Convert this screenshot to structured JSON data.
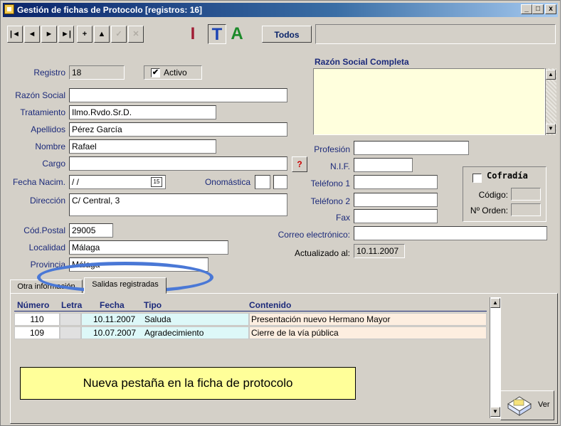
{
  "window": {
    "title": "Gestión de fichas de Protocolo  [registros: 16]",
    "controls": [
      "_",
      "□",
      "x"
    ]
  },
  "toolbar": {
    "nav": [
      "|◄",
      "◄",
      "►",
      "►|",
      "+",
      "▲",
      "✓",
      "✕"
    ],
    "letters": [
      {
        "text": "I",
        "color": "#a01c34"
      },
      {
        "text": "T",
        "color": "#1c44b4"
      },
      {
        "text": "A",
        "color": "#1c8a2a"
      }
    ],
    "todos": "Todos"
  },
  "form": {
    "registro": {
      "label": "Registro",
      "value": "18"
    },
    "activo": {
      "label": "Activo",
      "checked": "✔"
    },
    "razon_social": {
      "label": "Razón Social",
      "value": ""
    },
    "tratamiento": {
      "label": "Tratamiento",
      "value": "Ilmo.Rvdo.Sr.D."
    },
    "apellidos": {
      "label": "Apellidos",
      "value": "Pérez García"
    },
    "nombre": {
      "label": "Nombre",
      "value": "Rafael"
    },
    "cargo": {
      "label": "Cargo",
      "value": "",
      "help": "?"
    },
    "fecha_nacim": {
      "label": "Fecha Nacim.",
      "value": " / /",
      "calendar": "15"
    },
    "onomastica": {
      "label": "Onomástica"
    },
    "direccion": {
      "label": "Dirección",
      "value": "C/ Central, 3"
    },
    "cod_postal": {
      "label": "Cód.Postal",
      "value": "29005"
    },
    "localidad": {
      "label": "Localidad",
      "value": "Málaga"
    },
    "provincia": {
      "label": "Provincia",
      "value": "Málaga"
    },
    "razon_completa": {
      "label": "Razón Social Completa"
    },
    "profesion": {
      "label": "Profesión"
    },
    "nif": {
      "label": "N.I.F."
    },
    "telefono1": {
      "label": "Teléfono 1"
    },
    "telefono2": {
      "label": "Teléfono 2"
    },
    "fax": {
      "label": "Fax"
    },
    "correo": {
      "label": "Correo electrónico:"
    },
    "actualizado": {
      "label": "Actualizado al:",
      "value": "10.11.2007"
    },
    "cofradia": {
      "label": "Cofradía",
      "codigo": "Código:",
      "orden": "Nº Orden:"
    }
  },
  "tabs": [
    {
      "label": "Otra información"
    },
    {
      "label": "Salidas registradas",
      "active": true
    }
  ],
  "grid": {
    "columns": [
      "Número",
      "Letra",
      "Fecha",
      "Tipo",
      "Contenido"
    ],
    "rows": [
      {
        "numero": "110",
        "letra": "",
        "fecha": "10.11.2007",
        "tipo": "Saluda",
        "contenido": "Presentación nuevo Hermano Mayor"
      },
      {
        "numero": "109",
        "letra": "",
        "fecha": "10.07.2007",
        "tipo": "Agradecimiento",
        "contenido": "Cierre de la vía pública"
      }
    ]
  },
  "annotation": "Nueva pestaña en la ficha de protocolo",
  "ver_button": "Ver",
  "colors": {
    "label_blue": "#1c2a7a",
    "memo_yellow": "#ffffdd",
    "row_blue": "#ddf8f8",
    "row_peach": "#fdeee0",
    "highlight": "#4a78d6"
  }
}
